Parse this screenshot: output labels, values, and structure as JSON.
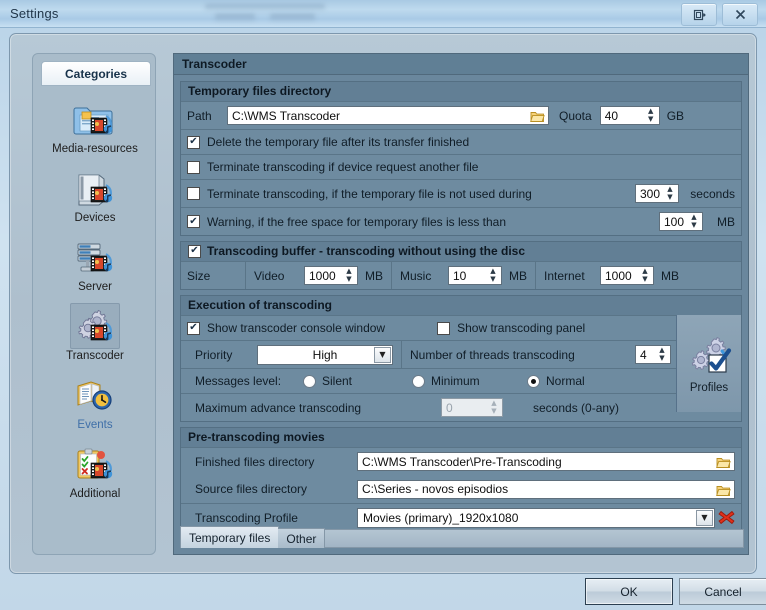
{
  "window": {
    "title": "Settings",
    "restore_icon": "restore-icon",
    "close_icon": "close-icon"
  },
  "sidebar": {
    "header": "Categories",
    "items": [
      {
        "label": "Media-resources",
        "icon": "folder-media-icon",
        "selected": false
      },
      {
        "label": "Devices",
        "icon": "device-media-icon",
        "selected": false
      },
      {
        "label": "Server",
        "icon": "server-media-icon",
        "selected": false
      },
      {
        "label": "Transcoder",
        "icon": "gears-media-icon",
        "selected": true
      },
      {
        "label": "Events",
        "icon": "book-clock-icon",
        "selected": false
      },
      {
        "label": "Additional",
        "icon": "clipboard-media-icon",
        "selected": false
      }
    ]
  },
  "content": {
    "banner": "Transcoder",
    "temp_files": {
      "title": "Temporary files directory",
      "path_label": "Path",
      "path_value": "C:\\WMS Transcoder",
      "path_browse_icon": "folder-open-icon",
      "quota_label": "Quota",
      "quota_value": "40",
      "quota_unit": "GB",
      "checkboxes": [
        {
          "label": "Delete the temporary file after its transfer finished",
          "checked": true
        },
        {
          "label": "Terminate transcoding if device request another file",
          "checked": false
        },
        {
          "label": "Terminate transcoding, if the temporary file is not used during",
          "checked": false,
          "value": "300",
          "unit": "seconds"
        },
        {
          "label": "Warning, if the free space for temporary files is less than",
          "checked": true,
          "value": "100",
          "unit": "MB"
        }
      ]
    },
    "buffer": {
      "title": "Transcoding buffer  - transcoding without using the disc",
      "checked": true,
      "size_label": "Size",
      "fields": [
        {
          "label": "Video",
          "value": "1000",
          "unit": "MB"
        },
        {
          "label": "Music",
          "value": "10",
          "unit": "MB"
        },
        {
          "label": "Internet",
          "value": "1000",
          "unit": "MB"
        }
      ]
    },
    "execution": {
      "title": "Execution of transcoding",
      "show_console_label": "Show transcoder console window",
      "show_console_checked": true,
      "show_panel_label": "Show transcoding panel",
      "show_panel_checked": false,
      "priority_label": "Priority",
      "priority_value": "High",
      "threads_label": "Number of threads transcoding",
      "threads_value": "4",
      "messages_label": "Messages level:",
      "messages_options": [
        {
          "label": "Silent",
          "selected": false
        },
        {
          "label": "Minimum",
          "selected": false
        },
        {
          "label": "Normal",
          "selected": true
        }
      ],
      "max_advance_label": "Maximum advance transcoding",
      "max_advance_value": "0",
      "max_advance_unit": "seconds (0-any)",
      "profiles_label": "Profiles",
      "profiles_icon": "gears-check-icon"
    },
    "pre_transcoding": {
      "title": "Pre-transcoding movies",
      "finished_label": "Finished files directory",
      "finished_value": "C:\\WMS Transcoder\\Pre-Transcoding",
      "source_label": "Source files directory",
      "source_value": "C:\\Series - novos episodios",
      "browse_icon": "folder-open-icon",
      "profile_label": "Transcoding Profile",
      "profile_value": "Movies (primary)_1920x1080",
      "profile_dropdown_icon": "chevron-down-icon",
      "profile_delete_icon": "red-x-delete-icon"
    },
    "tabs": [
      {
        "label": "Temporary files",
        "active": true
      },
      {
        "label": "Other",
        "active": false
      }
    ]
  },
  "footer": {
    "ok_label": "OK",
    "cancel_label": "Cancel"
  },
  "colors": {
    "window_bg": "#c2d7e8",
    "panel_bg": "#6a879d",
    "group_bg": "#6e8ba0",
    "banner_bg": "#607f95",
    "sidebar_bg": "#a9bcca",
    "link": "#3f6fa8",
    "delete_red": "#d62914",
    "folder_yellow": "#f4c54a"
  }
}
